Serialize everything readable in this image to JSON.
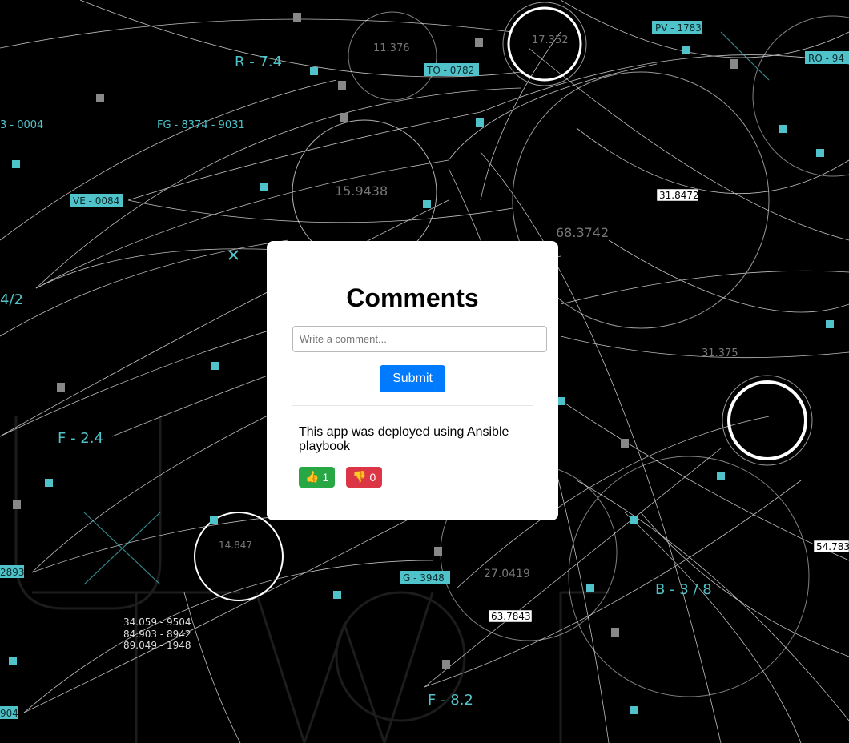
{
  "comments_panel": {
    "title": "Comments",
    "input_placeholder": "Write a comment...",
    "input_value": "",
    "submit_label": "Submit"
  },
  "comments": [
    {
      "text": "This app was deployed using Ansible playbook",
      "likes": "1",
      "dislikes": "0",
      "like_icon": "thumbs-up-icon",
      "dislike_icon": "thumbs-down-icon"
    }
  ],
  "background": {
    "labels": {
      "r74": "R - 7.4",
      "fg": "FG - 8374 - 9031",
      "ve": "VE - 0084",
      "to": "TO - 0782",
      "pv": "PV - 1783",
      "ro": "RO - 94",
      "n3": "3 - 0004",
      "f24": "F - 2.4",
      "f82": "F - 8.2",
      "b38": "B - 3 / 8",
      "g": "G - 3948",
      "n42": "4/2",
      "n2893": "2893",
      "n904": "904",
      "v11376": "11.376",
      "v17352": "17.352",
      "v15948": "15.9438",
      "v68374": "68.3742",
      "v31847": "31.8472",
      "v31375": "31.375",
      "v14847": "14.847",
      "v27": "27.0419",
      "v63": "63.7843",
      "v54": "54.783",
      "c1": "34.059 - 9504",
      "c2": "84.903 - 8942",
      "c3": "89.049 - 1948"
    },
    "accent_color": "#4fc3c9",
    "line_color": "#ffffff"
  },
  "colors": {
    "card": "#ffffff",
    "submit": "#007bff",
    "like": "#28a745",
    "dislike": "#dc3545"
  }
}
